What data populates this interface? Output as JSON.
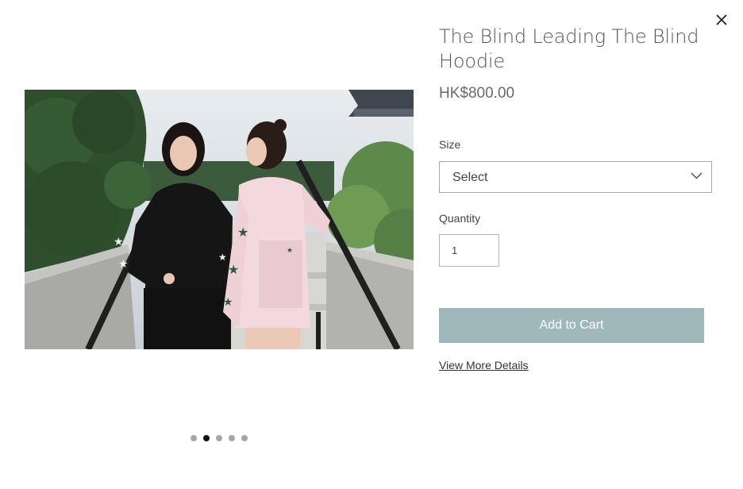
{
  "product": {
    "title": "The Blind Leading The Blind Hoodie",
    "price": "HK$800.00"
  },
  "size": {
    "label": "Size",
    "selected": "Select"
  },
  "quantity": {
    "label": "Quantity",
    "value": "1"
  },
  "actions": {
    "add_to_cart": "Add to Cart",
    "view_details": "View More Details"
  },
  "gallery": {
    "total_images": 5,
    "active_index": 1
  },
  "icons": {
    "close": "close-icon",
    "dropdown": "chevron-down-icon"
  },
  "colors": {
    "button": "#9eb8bb",
    "active_dot": "#111111",
    "inactive_dot": "#a6a6a6"
  }
}
